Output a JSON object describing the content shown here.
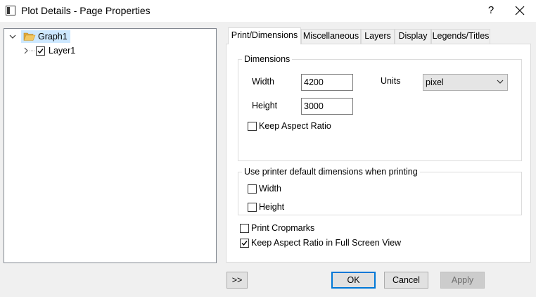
{
  "window": {
    "title": "Plot Details - Page Properties",
    "help_label": "?"
  },
  "tree": {
    "root_label": "Graph1",
    "child_label": "Layer1"
  },
  "tabs": [
    {
      "label": "Print/Dimensions",
      "active": true
    },
    {
      "label": "Miscellaneous",
      "active": false
    },
    {
      "label": "Layers",
      "active": false
    },
    {
      "label": "Display",
      "active": false
    },
    {
      "label": "Legends/Titles",
      "active": false
    }
  ],
  "dimensions": {
    "group_title": "Dimensions",
    "width_label": "Width",
    "width_value": "4200",
    "height_label": "Height",
    "height_value": "3000",
    "units_label": "Units",
    "units_value": "pixel",
    "keep_aspect_label": "Keep Aspect Ratio",
    "keep_aspect_checked": false
  },
  "printer": {
    "group_title": "Use printer default dimensions when printing",
    "width_label": "Width",
    "width_checked": false,
    "height_label": "Height",
    "height_checked": false
  },
  "options": {
    "print_cropmarks_label": "Print Cropmarks",
    "print_cropmarks_checked": false,
    "keep_aspect_fullscreen_label": "Keep Aspect Ratio in Full Screen View",
    "keep_aspect_fullscreen_checked": true
  },
  "buttons": {
    "expand_label": ">>",
    "ok_label": "OK",
    "cancel_label": "Cancel",
    "apply_label": "Apply"
  },
  "colors": {
    "selection": "#cde8ff",
    "default_button_border": "#0078d7",
    "folder": "#f3c762"
  }
}
